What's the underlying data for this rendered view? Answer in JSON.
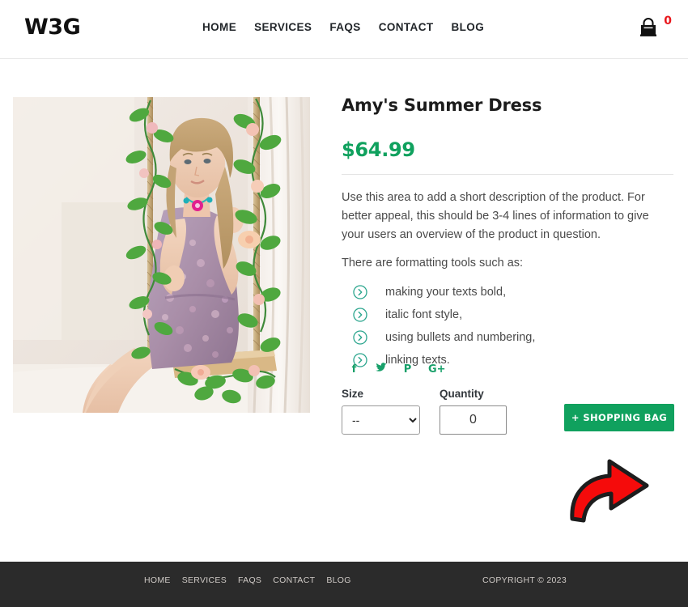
{
  "header": {
    "logo": "W3G",
    "nav": [
      {
        "label": "HOME"
      },
      {
        "label": "SERVICES"
      },
      {
        "label": "FAQS"
      },
      {
        "label": "CONTACT"
      },
      {
        "label": "BLOG"
      }
    ],
    "cart": {
      "icon": "shopping-bag-icon",
      "count": "0",
      "count_color": "#e8161b"
    }
  },
  "product": {
    "image_alt": "Young woman in floral summer dress sitting on a flower-decorated rope swing",
    "title": "Amy's Summer Dress",
    "price": "$64.99",
    "price_color": "#10a15e",
    "description": "Use this area to add a short description of the product. For better appeal, this should be 3-4 lines of information to give your users an overview of the product in question.",
    "formatting_intro": "There are formatting tools such as:",
    "features": [
      {
        "icon": "chevron-right-circle-icon",
        "label": "making your texts bold,"
      },
      {
        "icon": "chevron-right-circle-icon",
        "label": "italic font style,"
      },
      {
        "icon": "chevron-right-circle-icon",
        "label": "using bullets and numbering,"
      },
      {
        "icon": "chevron-right-circle-icon",
        "label": "linking texts."
      }
    ],
    "social": [
      {
        "icon": "facebook-icon",
        "glyph": "f"
      },
      {
        "icon": "twitter-icon",
        "glyph": "ᵗ"
      },
      {
        "icon": "pinterest-icon",
        "glyph": "P"
      },
      {
        "icon": "google-plus-icon",
        "glyph": "G+"
      }
    ],
    "social_color": "#18a06a"
  },
  "form": {
    "size_label": "Size",
    "size_value": "--",
    "size_options": [
      "--"
    ],
    "quantity_label": "Quantity",
    "quantity_value": "0",
    "add_to_bag_label": "+ SHOPPING BAG",
    "add_to_bag_color": "#10a15e"
  },
  "annotation": {
    "arrow": "red-curved-arrow-pointing-up-right",
    "arrow_color": "#f50b0b",
    "target": "add-to-shopping-bag-button"
  },
  "footer": {
    "background": "#2b2b2b",
    "nav": [
      {
        "label": "HOME"
      },
      {
        "label": "SERVICES"
      },
      {
        "label": "FAQS"
      },
      {
        "label": "CONTACT"
      },
      {
        "label": "BLOG"
      }
    ],
    "copyright": "COPYRIGHT © 2023"
  }
}
